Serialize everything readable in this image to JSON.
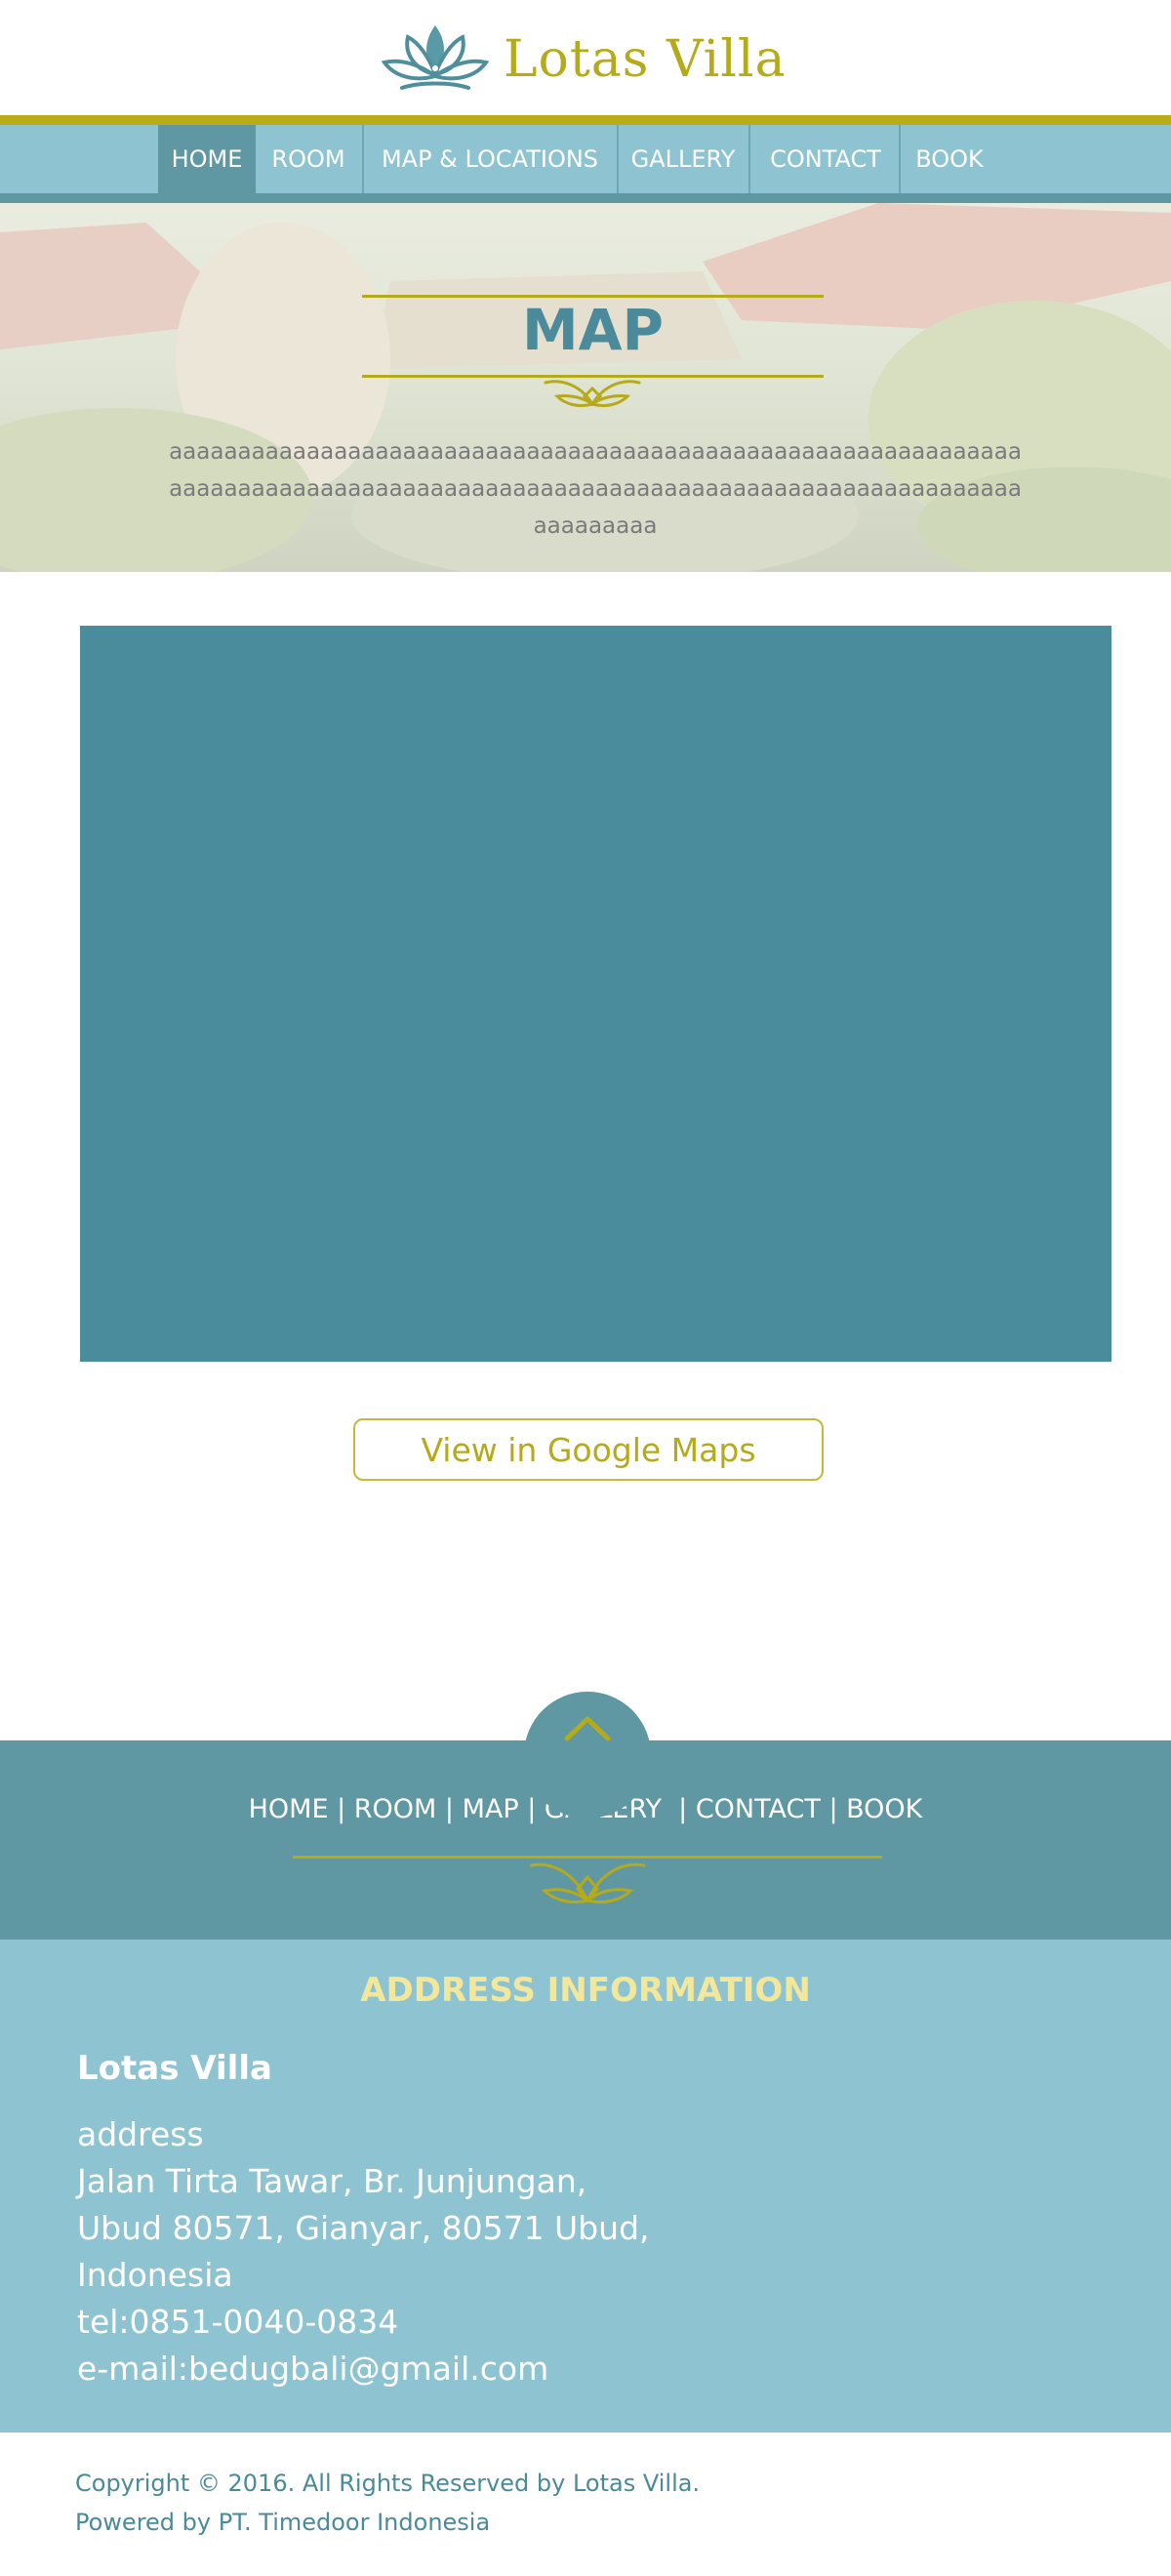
{
  "brand": {
    "name": "Lotas Villa",
    "colors": {
      "gold": "#b5ab1a",
      "teal": "#4a8b9c",
      "light_blue": "#8ec4d2",
      "dark_teal": "#5f97a3"
    },
    "logo_icon": "lotus-icon"
  },
  "nav": {
    "items": [
      {
        "label": "HOME",
        "active": true
      },
      {
        "label": "ROOM",
        "active": false
      },
      {
        "label": "MAP &  LOCATIONS",
        "active": false
      },
      {
        "label": "GALLERY",
        "active": false
      },
      {
        "label": "CONTACT",
        "active": false
      },
      {
        "label": "BOOK",
        "active": false
      }
    ]
  },
  "hero": {
    "title": "MAP",
    "text": "aaaaaaaaaaaaaaaaaaaaaaaaaaaaaaaaaaaaaaaaaaaaaaaaaaaaaaaaaaaaaaaaaaaaaaaaaaaaaaaaaaaaaaaaaaaaaaaaaaaaaaaaaaaaaaaaaaaaaaaaaaaaaaaaaaaaa"
  },
  "map": {
    "button_label": "View in Google Maps"
  },
  "footer": {
    "scroll_top_icon": "chevron-up-icon",
    "links_text": "HOME | ROOM | MAP | GALLERY  | CONTACT | BOOK"
  },
  "address": {
    "heading": "ADDRESS INFORMATION",
    "name": "Lotas Villa",
    "label": "address",
    "line1": "Jalan Tirta Tawar, Br. Junjungan,",
    "line2": "Ubud 80571, Gianyar, 80571 Ubud,",
    "line3": "Indonesia",
    "tel": "tel:0851-0040-0834",
    "email": "e-mail:bedugbali@gmail.com"
  },
  "copyright": {
    "line1": "Copyright © 2016. All Rights Reserved by Lotas Villa.",
    "line2": "Powered by PT. Timedoor Indonesia"
  }
}
